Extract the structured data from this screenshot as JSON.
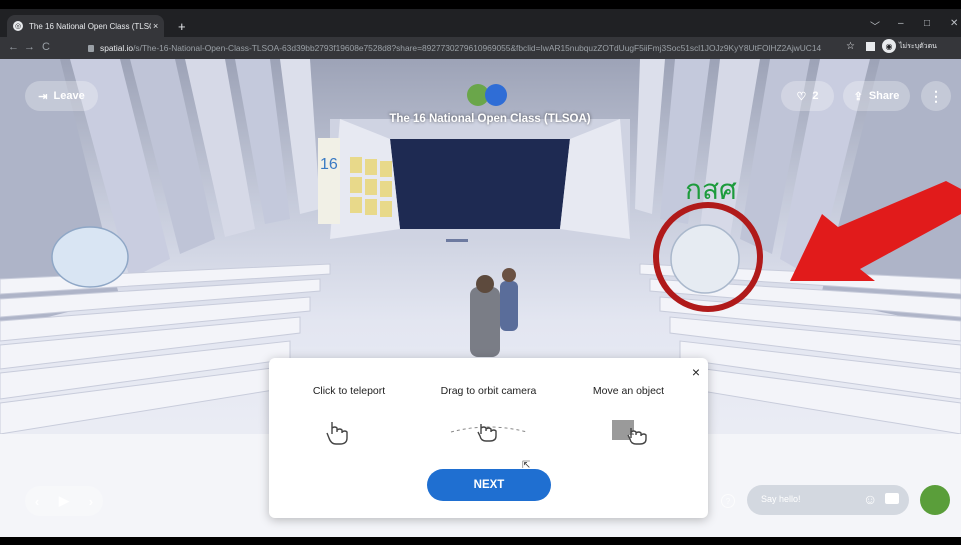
{
  "browser": {
    "tab_title": "The 16 National Open Class (TLSOA)",
    "tab_close": "×",
    "new_tab": "+",
    "url_host": "spatial.io",
    "url_path": "/s/The-16-National-Open-Class-TLSOA-63d39bb2793f19608e7528d8?share=8927730279610969055&fbclid=IwAR15nubquzZOTdUugF5iiFmj3Soc51scl1JOJz9KyY8UtFOlHZ2AjwUC14",
    "profile_name": "ไม่ระบุตัวตน",
    "window_controls": [
      "﹀",
      "–",
      "□",
      "✕"
    ]
  },
  "toolbar": {
    "leave_label": "Leave",
    "likes_count": "2",
    "share_label": "Share",
    "more_glyph": "⋮"
  },
  "room": {
    "title": "The 16 National Open Class (TLSOA)",
    "sign_text": "กสศ",
    "poster_number": "16"
  },
  "hint_dialog": {
    "close": "×",
    "hints": [
      {
        "label": "Click to teleport",
        "icon": "hand-pointer-icon"
      },
      {
        "label": "Drag to orbit camera",
        "icon": "drag-orbit-icon"
      },
      {
        "label": "Move an object",
        "icon": "move-object-icon"
      }
    ],
    "next_label": "NEXT"
  },
  "chat": {
    "placeholder": "Say hello!",
    "help": "?"
  },
  "annotation": {
    "circle_color": "#b01a1a",
    "arrow_color": "#e11b1b"
  },
  "colors": {
    "next_button": "#1f6fd1"
  }
}
